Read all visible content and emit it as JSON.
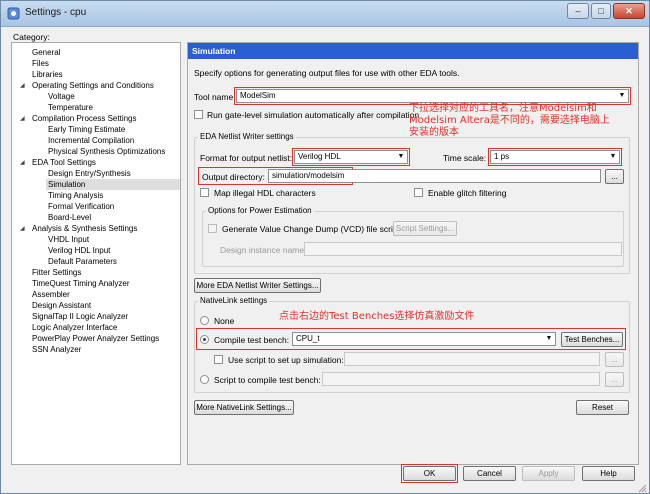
{
  "window": {
    "title": "Settings - cpu",
    "min": "–",
    "max": "□",
    "close": "✕"
  },
  "category_label": "Category:",
  "tree": [
    {
      "label": "General",
      "expander": "",
      "selected": false
    },
    {
      "label": "Files",
      "expander": "",
      "selected": false
    },
    {
      "label": "Libraries",
      "expander": "",
      "selected": false
    },
    {
      "label": "Operating Settings and Conditions",
      "expander": "◢",
      "selected": false
    },
    {
      "label": "Voltage",
      "expander": "",
      "selected": false
    },
    {
      "label": "Temperature",
      "expander": "",
      "selected": false
    },
    {
      "label": "Compilation Process Settings",
      "expander": "◢",
      "selected": false
    },
    {
      "label": "Early Timing Estimate",
      "expander": "",
      "selected": false
    },
    {
      "label": "Incremental Compilation",
      "expander": "",
      "selected": false
    },
    {
      "label": "Physical Synthesis Optimizations",
      "expander": "",
      "selected": false
    },
    {
      "label": "EDA Tool Settings",
      "expander": "◢",
      "selected": false
    },
    {
      "label": "Design Entry/Synthesis",
      "expander": "",
      "selected": false
    },
    {
      "label": "Simulation",
      "expander": "",
      "selected": true
    },
    {
      "label": "Timing Analysis",
      "expander": "",
      "selected": false
    },
    {
      "label": "Formal Verification",
      "expander": "",
      "selected": false
    },
    {
      "label": "Board-Level",
      "expander": "",
      "selected": false
    },
    {
      "label": "Analysis & Synthesis Settings",
      "expander": "◢",
      "selected": false
    },
    {
      "label": "VHDL Input",
      "expander": "",
      "selected": false
    },
    {
      "label": "Verilog HDL Input",
      "expander": "",
      "selected": false
    },
    {
      "label": "Default Parameters",
      "expander": "",
      "selected": false
    },
    {
      "label": "Fitter Settings",
      "expander": "",
      "selected": false
    },
    {
      "label": "TimeQuest Timing Analyzer",
      "expander": "",
      "selected": false
    },
    {
      "label": "Assembler",
      "expander": "",
      "selected": false
    },
    {
      "label": "Design Assistant",
      "expander": "",
      "selected": false
    },
    {
      "label": "SignalTap II Logic Analyzer",
      "expander": "",
      "selected": false
    },
    {
      "label": "Logic Analyzer Interface",
      "expander": "",
      "selected": false
    },
    {
      "label": "PowerPlay Power Analyzer Settings",
      "expander": "",
      "selected": false
    },
    {
      "label": "SSN Analyzer",
      "expander": "",
      "selected": false
    }
  ],
  "panel": {
    "header": "Simulation",
    "description": "Specify options for generating output files for use with other EDA tools.",
    "tool_name_label": "Tool name:",
    "tool_name_value": "ModelSim",
    "run_gate_level_label": "Run gate-level simulation automatically after compilation",
    "netlist_group_title": "EDA Netlist Writer settings",
    "format_label": "Format for output netlist:",
    "format_value": "Verilog HDL",
    "time_scale_label": "Time scale:",
    "time_scale_value": "1 ps",
    "output_dir_label": "Output directory:",
    "output_dir_value": "simulation/modelsim",
    "browse_label": "...",
    "map_illegal_label": "Map illegal HDL characters",
    "glitch_label": "Enable glitch filtering",
    "power_group_title": "Options for Power Estimation",
    "vcd_label": "Generate Value Change Dump (VCD) file script",
    "script_settings_label": "Script Settings...",
    "design_instance_label": "Design instance name:",
    "more_eda_label": "More EDA Netlist Writer Settings...",
    "nativelink_group_title": "NativeLink settings",
    "none_label": "None",
    "compile_tb_label": "Compile test bench:",
    "compile_tb_value": "CPU_t",
    "test_benches_label": "Test Benches...",
    "use_script_label": "Use script to set up simulation:",
    "script_compile_label": "Script to compile test bench:",
    "more_nativelink_label": "More NativeLink Settings...",
    "reset_label": "Reset"
  },
  "annotations": {
    "tool_note_line1": "下拉选择对应的工具名，注意Modelsim和",
    "tool_note_line2": "Modelsim Altera是不同的，需要选择电脑上",
    "tool_note_line3": "安装的版本",
    "testbench_note": "点击右边的Test Benches选择仿真激励文件"
  },
  "footer": {
    "ok": "OK",
    "cancel": "Cancel",
    "apply": "Apply",
    "help": "Help"
  },
  "colors": {
    "header_blue": "#2a5fd2",
    "annotation_red": "#e0312b"
  }
}
